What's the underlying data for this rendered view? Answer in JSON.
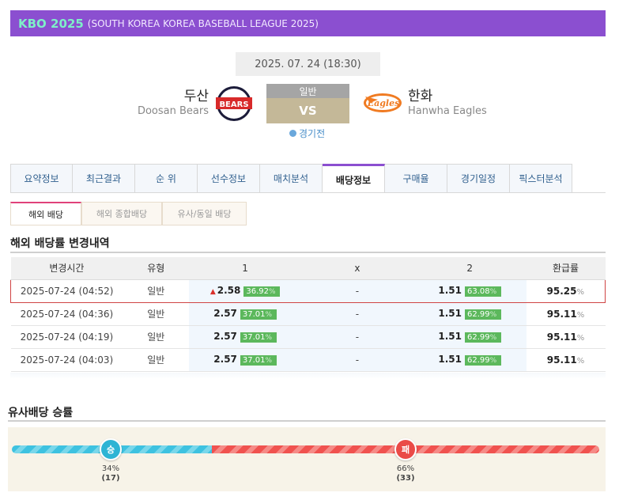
{
  "league": {
    "name": "KBO 2025",
    "subtitle": "(SOUTH KOREA KOREA BASEBALL LEAGUE 2025)"
  },
  "match": {
    "datetime": "2025. 07. 24 (18:30)",
    "type": "일반",
    "vs": "VS",
    "status": "경기전",
    "home": {
      "name_kr": "두산",
      "name_en": "Doosan Bears",
      "logo_text": "BEARS"
    },
    "away": {
      "name_kr": "한화",
      "name_en": "Hanwha Eagles",
      "logo_text": "Eagles"
    }
  },
  "tabs": [
    "요약정보",
    "최근결과",
    "순 위",
    "선수정보",
    "매치분석",
    "배당정보",
    "구매율",
    "경기일정",
    "픽스터분석"
  ],
  "active_tab": "배당정보",
  "subtabs": [
    "해외 배당",
    "해외 종합배당",
    "유사/동일 배당"
  ],
  "odds_section": {
    "title": "해외 배당률 변경내역",
    "headers": [
      "변경시간",
      "유형",
      "1",
      "x",
      "2",
      "환급률"
    ],
    "rows": [
      {
        "time": "2025-07-24 (04:52)",
        "type": "일반",
        "odd1": "2.58",
        "pct1": "36.92",
        "x": "-",
        "odd2": "1.51",
        "pct2": "63.08",
        "refund": "95.25",
        "up": true
      },
      {
        "time": "2025-07-24 (04:36)",
        "type": "일반",
        "odd1": "2.57",
        "pct1": "37.01",
        "x": "-",
        "odd2": "1.51",
        "pct2": "62.99",
        "refund": "95.11",
        "up": false
      },
      {
        "time": "2025-07-24 (04:19)",
        "type": "일반",
        "odd1": "2.57",
        "pct1": "37.01",
        "x": "-",
        "odd2": "1.51",
        "pct2": "62.99",
        "refund": "95.11",
        "up": false
      },
      {
        "time": "2025-07-24 (04:03)",
        "type": "일반",
        "odd1": "2.57",
        "pct1": "37.01",
        "x": "-",
        "odd2": "1.51",
        "pct2": "62.99",
        "refund": "95.11",
        "up": false
      }
    ],
    "pct_symbol": "%"
  },
  "similar_section": {
    "title": "유사배당 승률",
    "win": {
      "label": "승",
      "percent": "34%",
      "count": "(17)",
      "ratio": 0.34
    },
    "lose": {
      "label": "패",
      "percent": "66%",
      "count": "(33)",
      "ratio": 0.66
    }
  },
  "colors": {
    "league_bar": "#8b4fd0",
    "league_name": "#7ef0c8",
    "win": "#2db4d4",
    "lose": "#ea4b47",
    "pct_badge": "#5cb85c"
  }
}
